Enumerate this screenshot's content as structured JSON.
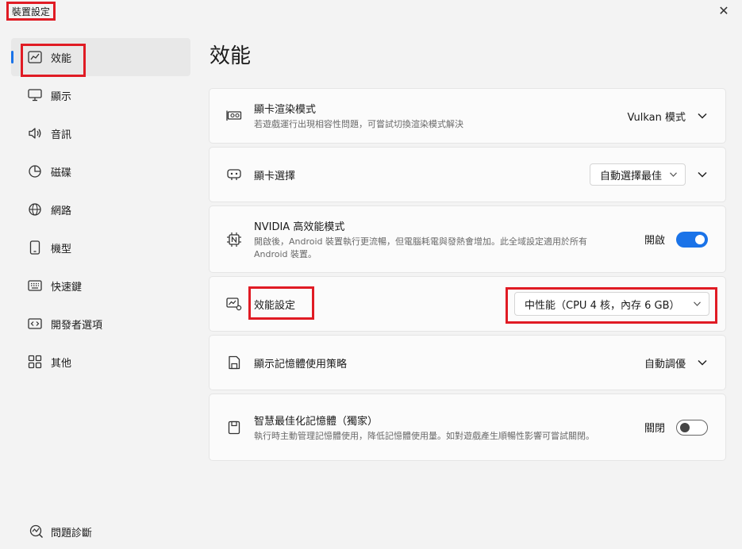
{
  "window": {
    "title": "裝置設定",
    "close_glyph": "✕"
  },
  "sidebar": {
    "items": [
      {
        "label": "效能",
        "icon": "chart-line-icon"
      },
      {
        "label": "顯示",
        "icon": "monitor-icon"
      },
      {
        "label": "音訊",
        "icon": "speaker-icon"
      },
      {
        "label": "磁碟",
        "icon": "pie-chart-icon"
      },
      {
        "label": "網路",
        "icon": "globe-icon"
      },
      {
        "label": "機型",
        "icon": "phone-icon"
      },
      {
        "label": "快速鍵",
        "icon": "keyboard-icon"
      },
      {
        "label": "開發者選項",
        "icon": "code-icon"
      },
      {
        "label": "其他",
        "icon": "grid-icon"
      }
    ],
    "active_index": 0,
    "diagnostics": {
      "label": "問題診斷",
      "icon": "diagnostics-icon"
    }
  },
  "main": {
    "title": "效能",
    "settings": [
      {
        "title": "顯卡渲染模式",
        "desc": "若遊戲運行出現相容性問題，可嘗試切換渲染模式解決",
        "value": "Vulkan 模式",
        "control": "chevron"
      },
      {
        "title": "顯卡選擇",
        "value": "自動選擇最佳",
        "control": "dropdown-chevron"
      },
      {
        "title": "NVIDIA 高效能模式",
        "desc": "開啟後，Android 裝置執行更流暢，但電腦耗電與發熱會增加。此全域設定適用於所有 Android 裝置。",
        "value": "開啟",
        "control": "toggle",
        "state": "on"
      },
      {
        "title": "效能設定",
        "value": "中性能（CPU 4 核，內存 6 GB）",
        "control": "dropdown"
      },
      {
        "title": "顯示記憶體使用策略",
        "value": "自動調優",
        "control": "chevron"
      },
      {
        "title": "智慧最佳化記憶體（獨家）",
        "desc": "執行時主動管理記憶體使用，降低記憶體使用量。如對遊戲產生順暢性影響可嘗試關閉。",
        "value": "關閉",
        "control": "toggle",
        "state": "off"
      }
    ]
  },
  "colors": {
    "accent": "#1a73e8",
    "highlight": "#e01b24"
  }
}
